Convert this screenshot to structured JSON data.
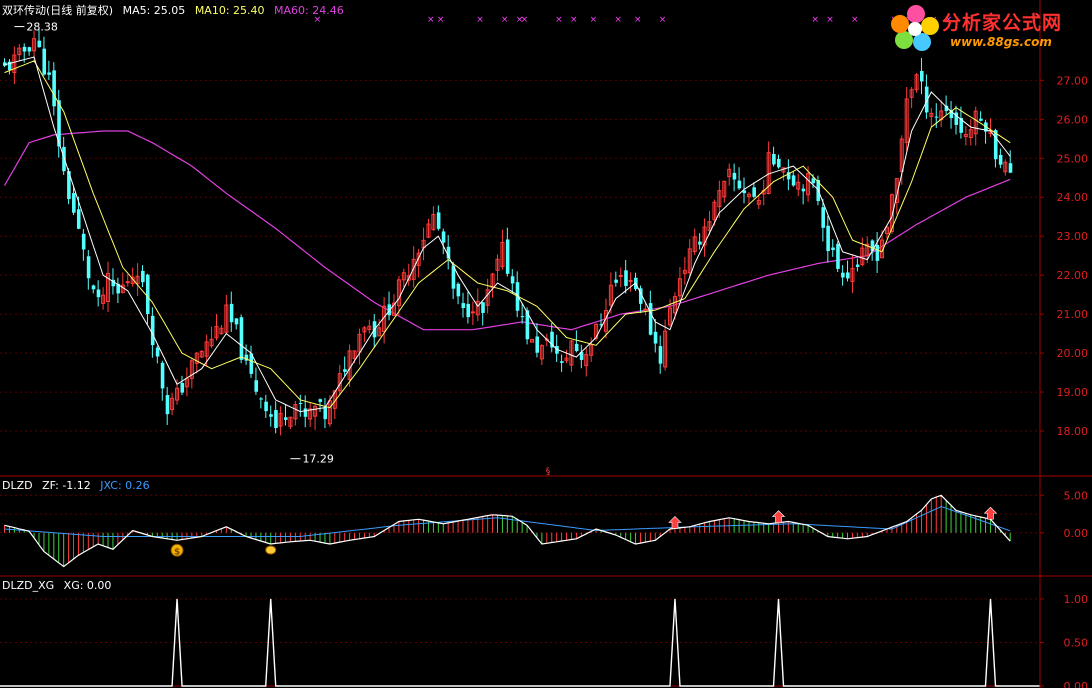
{
  "header": {
    "stock_name": "双环传动(日线 前复权)",
    "ma5": "MA5: 25.05",
    "ma10": "MA10: 25.40",
    "ma60": "MA60: 24.46"
  },
  "colors": {
    "up": "#ff3b3b",
    "down": "#54ffff",
    "ma5": "#ffffff",
    "ma10": "#ffff66",
    "ma60": "#e040e0",
    "axis": "#a00000",
    "label": "#dd2020",
    "signal": "#ff40ff",
    "zf": "#ffffff",
    "jxc": "#3a9cff"
  },
  "logo": {
    "title": "分析家公式网",
    "url": "www.88gs.com"
  },
  "indicator1": {
    "title": "DLZD",
    "zf_label": "ZF: -1.12",
    "jxc_label": "JXC: 0.26"
  },
  "indicator2": {
    "title": "DLZD_XG",
    "xg_label": "XG: 0.00"
  },
  "chart_data": [
    {
      "type": "candlestick",
      "yaxis_ticks": [
        18.0,
        19.0,
        20.0,
        21.0,
        22.0,
        23.0,
        24.0,
        25.0,
        26.0,
        27.0
      ],
      "ylim": [
        17.0,
        28.6
      ],
      "annotations": [
        {
          "text": "28.38",
          "value": 28.38,
          "bar": 2
        },
        {
          "text": "17.29",
          "value": 17.29,
          "bar": 58
        }
      ],
      "close_path": [
        [
          0,
          27.3
        ],
        [
          3,
          27.6
        ],
        [
          6,
          28.1
        ],
        [
          9,
          27.0
        ],
        [
          12,
          24.6
        ],
        [
          15,
          23.1
        ],
        [
          17,
          22.0
        ],
        [
          19,
          21.2
        ],
        [
          21,
          21.8
        ],
        [
          23,
          21.5
        ],
        [
          25,
          21.9
        ],
        [
          27,
          22.2
        ],
        [
          29,
          21.1
        ],
        [
          31,
          19.8
        ],
        [
          33,
          18.6
        ],
        [
          35,
          18.9
        ],
        [
          37,
          19.4
        ],
        [
          39,
          19.9
        ],
        [
          41,
          20.2
        ],
        [
          43,
          20.6
        ],
        [
          45,
          21.0
        ],
        [
          47,
          20.5
        ],
        [
          49,
          19.6
        ],
        [
          51,
          19.1
        ],
        [
          53,
          18.7
        ],
        [
          55,
          18.1
        ],
        [
          57,
          18.5
        ],
        [
          59,
          18.7
        ],
        [
          61,
          18.3
        ],
        [
          63,
          18.6
        ],
        [
          65,
          18.4
        ],
        [
          67,
          18.9
        ],
        [
          69,
          19.7
        ],
        [
          71,
          20.3
        ],
        [
          73,
          20.8
        ],
        [
          75,
          20.6
        ],
        [
          77,
          21.0
        ],
        [
          79,
          21.4
        ],
        [
          81,
          21.9
        ],
        [
          83,
          22.5
        ],
        [
          85,
          23.0
        ],
        [
          87,
          23.5
        ],
        [
          89,
          22.8
        ],
        [
          91,
          21.6
        ],
        [
          93,
          21.0
        ],
        [
          95,
          21.3
        ],
        [
          97,
          21.0
        ],
        [
          99,
          21.9
        ],
        [
          101,
          22.6
        ],
        [
          103,
          21.8
        ],
        [
          105,
          20.8
        ],
        [
          107,
          20.2
        ],
        [
          109,
          20.1
        ],
        [
          111,
          20.3
        ],
        [
          113,
          19.6
        ],
        [
          115,
          20.3
        ],
        [
          117,
          19.9
        ],
        [
          119,
          20.3
        ],
        [
          121,
          20.8
        ],
        [
          123,
          21.7
        ],
        [
          125,
          21.9
        ],
        [
          127,
          21.9
        ],
        [
          129,
          21.4
        ],
        [
          131,
          20.6
        ],
        [
          133,
          19.9
        ],
        [
          135,
          21.1
        ],
        [
          137,
          22.0
        ],
        [
          139,
          22.5
        ],
        [
          141,
          23.0
        ],
        [
          143,
          23.5
        ],
        [
          145,
          24.0
        ],
        [
          147,
          24.5
        ],
        [
          149,
          24.3
        ],
        [
          151,
          24.1
        ],
        [
          153,
          23.9
        ],
        [
          155,
          24.9
        ],
        [
          157,
          25.0
        ],
        [
          159,
          24.6
        ],
        [
          161,
          24.4
        ],
        [
          163,
          24.4
        ],
        [
          165,
          24.0
        ],
        [
          167,
          22.8
        ],
        [
          169,
          22.2
        ],
        [
          171,
          22.1
        ],
        [
          173,
          22.3
        ],
        [
          175,
          22.6
        ],
        [
          177,
          22.6
        ],
        [
          179,
          23.3
        ],
        [
          181,
          24.4
        ],
        [
          183,
          26.6
        ],
        [
          185,
          27.1
        ],
        [
          187,
          26.4
        ],
        [
          189,
          26.1
        ],
        [
          191,
          26.3
        ],
        [
          193,
          25.9
        ],
        [
          195,
          25.6
        ],
        [
          197,
          26.0
        ],
        [
          199,
          25.9
        ],
        [
          201,
          25.2
        ],
        [
          203,
          24.8
        ],
        [
          204,
          24.5
        ]
      ],
      "series": [
        {
          "name": "MA5",
          "values": [
            [
              0,
              27.4
            ],
            [
              6,
              27.6
            ],
            [
              10,
              25.8
            ],
            [
              15,
              23.9
            ],
            [
              20,
              22.0
            ],
            [
              25,
              21.6
            ],
            [
              30,
              20.5
            ],
            [
              35,
              19.2
            ],
            [
              40,
              19.6
            ],
            [
              45,
              20.5
            ],
            [
              50,
              20.0
            ],
            [
              55,
              18.8
            ],
            [
              60,
              18.5
            ],
            [
              65,
              18.6
            ],
            [
              70,
              19.6
            ],
            [
              75,
              20.6
            ],
            [
              80,
              21.4
            ],
            [
              85,
              22.7
            ],
            [
              88,
              23.0
            ],
            [
              92,
              22.0
            ],
            [
              96,
              21.2
            ],
            [
              100,
              21.8
            ],
            [
              104,
              21.5
            ],
            [
              108,
              20.6
            ],
            [
              112,
              20.1
            ],
            [
              116,
              19.9
            ],
            [
              120,
              20.4
            ],
            [
              124,
              21.4
            ],
            [
              128,
              21.8
            ],
            [
              132,
              20.8
            ],
            [
              135,
              20.6
            ],
            [
              140,
              22.3
            ],
            [
              145,
              23.6
            ],
            [
              150,
              24.2
            ],
            [
              155,
              24.6
            ],
            [
              160,
              24.8
            ],
            [
              165,
              24.2
            ],
            [
              170,
              22.6
            ],
            [
              175,
              22.4
            ],
            [
              180,
              23.5
            ],
            [
              184,
              25.7
            ],
            [
              188,
              26.7
            ],
            [
              192,
              26.2
            ],
            [
              196,
              25.8
            ],
            [
              200,
              25.7
            ],
            [
              204,
              25.05
            ]
          ]
        },
        {
          "name": "MA10",
          "values": [
            [
              0,
              27.2
            ],
            [
              6,
              27.5
            ],
            [
              12,
              26.2
            ],
            [
              18,
              24.1
            ],
            [
              24,
              22.2
            ],
            [
              30,
              21.3
            ],
            [
              36,
              20.0
            ],
            [
              42,
              19.6
            ],
            [
              48,
              19.9
            ],
            [
              54,
              19.6
            ],
            [
              60,
              18.8
            ],
            [
              66,
              18.6
            ],
            [
              72,
              19.6
            ],
            [
              78,
              20.7
            ],
            [
              84,
              21.8
            ],
            [
              90,
              22.4
            ],
            [
              96,
              21.8
            ],
            [
              102,
              21.6
            ],
            [
              108,
              21.2
            ],
            [
              114,
              20.4
            ],
            [
              120,
              20.2
            ],
            [
              126,
              21.0
            ],
            [
              132,
              21.1
            ],
            [
              138,
              21.4
            ],
            [
              144,
              22.6
            ],
            [
              150,
              23.7
            ],
            [
              156,
              24.4
            ],
            [
              162,
              24.8
            ],
            [
              168,
              24.0
            ],
            [
              172,
              22.9
            ],
            [
              178,
              22.6
            ],
            [
              184,
              24.4
            ],
            [
              188,
              25.8
            ],
            [
              193,
              26.3
            ],
            [
              198,
              25.9
            ],
            [
              204,
              25.4
            ]
          ]
        },
        {
          "name": "MA60",
          "values": [
            [
              0,
              24.3
            ],
            [
              5,
              25.4
            ],
            [
              10,
              25.6
            ],
            [
              20,
              25.7
            ],
            [
              25,
              25.7
            ],
            [
              30,
              25.4
            ],
            [
              38,
              24.8
            ],
            [
              45,
              24.1
            ],
            [
              55,
              23.2
            ],
            [
              65,
              22.2
            ],
            [
              75,
              21.3
            ],
            [
              85,
              20.6
            ],
            [
              95,
              20.6
            ],
            [
              105,
              20.8
            ],
            [
              115,
              20.6
            ],
            [
              125,
              21.0
            ],
            [
              135,
              21.2
            ],
            [
              145,
              21.6
            ],
            [
              155,
              22.0
            ],
            [
              165,
              22.3
            ],
            [
              175,
              22.5
            ],
            [
              185,
              23.3
            ],
            [
              195,
              24.0
            ],
            [
              204,
              24.46
            ]
          ]
        }
      ],
      "signal_bars": [
        63,
        86,
        88,
        96,
        101,
        104,
        105,
        112,
        115,
        119,
        124,
        128,
        133,
        164,
        167,
        172,
        180,
        183,
        188,
        191
      ]
    },
    {
      "type": "bar",
      "title": "DLZD",
      "yaxis_ticks": [
        5.0,
        2.5,
        0.0
      ],
      "ylim": [
        -5.5,
        6.5
      ],
      "series": [
        {
          "name": "ZF",
          "values": [
            [
              0,
              1.0
            ],
            [
              5,
              0.2
            ],
            [
              8,
              -2.5
            ],
            [
              12,
              -4.5
            ],
            [
              15,
              -3.0
            ],
            [
              19,
              -1.5
            ],
            [
              22,
              -2.2
            ],
            [
              26,
              0.3
            ],
            [
              30,
              -0.5
            ],
            [
              35,
              -1.0
            ],
            [
              40,
              -0.5
            ],
            [
              45,
              0.8
            ],
            [
              49,
              -0.5
            ],
            [
              54,
              -1.5
            ],
            [
              58,
              -1.2
            ],
            [
              62,
              -1.0
            ],
            [
              66,
              -1.5
            ],
            [
              70,
              -1.0
            ],
            [
              75,
              -0.5
            ],
            [
              80,
              1.5
            ],
            [
              84,
              1.8
            ],
            [
              89,
              1.2
            ],
            [
              94,
              1.8
            ],
            [
              99,
              2.4
            ],
            [
              103,
              2.2
            ],
            [
              106,
              1.0
            ],
            [
              109,
              -1.5
            ],
            [
              112,
              -1.2
            ],
            [
              116,
              -0.8
            ],
            [
              120,
              0.5
            ],
            [
              124,
              -0.3
            ],
            [
              128,
              -1.5
            ],
            [
              132,
              -1.0
            ],
            [
              135,
              0.5
            ],
            [
              139,
              0.8
            ],
            [
              143,
              1.5
            ],
            [
              147,
              2.0
            ],
            [
              151,
              1.5
            ],
            [
              155,
              1.2
            ],
            [
              159,
              1.5
            ],
            [
              163,
              1.0
            ],
            [
              167,
              -0.5
            ],
            [
              171,
              -0.8
            ],
            [
              175,
              -0.5
            ],
            [
              179,
              0.5
            ],
            [
              183,
              1.5
            ],
            [
              186,
              3.0
            ],
            [
              188,
              4.5
            ],
            [
              190,
              5.0
            ],
            [
              193,
              3.0
            ],
            [
              196,
              2.4
            ],
            [
              200,
              1.8
            ],
            [
              204,
              -1.12
            ]
          ]
        },
        {
          "name": "JXC",
          "values": [
            [
              0,
              0.5
            ],
            [
              20,
              -0.5
            ],
            [
              40,
              -0.5
            ],
            [
              60,
              -0.5
            ],
            [
              80,
              1.0
            ],
            [
              100,
              2.0
            ],
            [
              120,
              0.3
            ],
            [
              140,
              0.8
            ],
            [
              160,
              1.2
            ],
            [
              180,
              0.5
            ],
            [
              190,
              3.5
            ],
            [
              204,
              0.26
            ]
          ]
        }
      ],
      "icons": [
        {
          "bar": 35,
          "icon": "money-bag-icon"
        },
        {
          "bar": 54,
          "icon": "hand-icon"
        },
        {
          "bar": 136,
          "icon": "up-arrow-icon"
        },
        {
          "bar": 157,
          "icon": "up-arrow-icon"
        },
        {
          "bar": 200,
          "icon": "up-arrow-icon"
        }
      ]
    },
    {
      "type": "line",
      "title": "DLZD_XG",
      "yaxis_ticks": [
        1.0,
        0.5,
        0.0
      ],
      "ylim": [
        0,
        1.08
      ],
      "spikes": [
        35,
        54,
        136,
        157,
        200
      ]
    }
  ]
}
